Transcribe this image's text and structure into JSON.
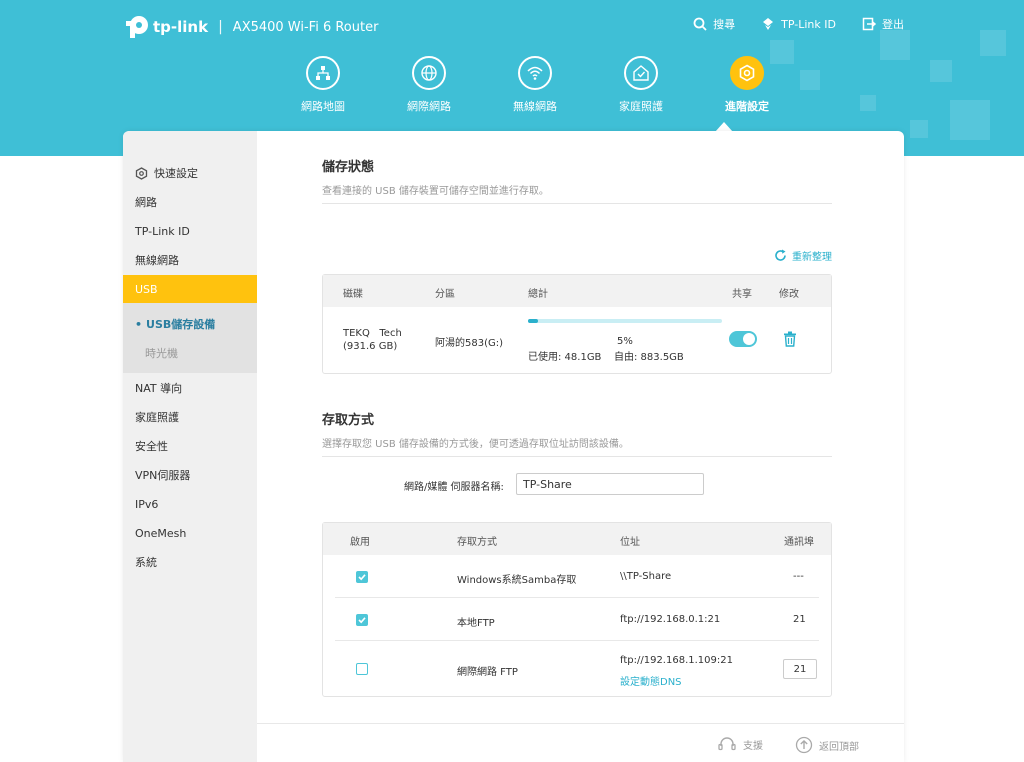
{
  "header": {
    "brand": "tp-link",
    "separator": "|",
    "model": "AX5400 Wi-Fi 6 Router",
    "top_links": [
      {
        "label": "搜尋",
        "icon": "search-icon"
      },
      {
        "label": "TP-Link ID",
        "icon": "tplink-id-icon"
      },
      {
        "label": "登出",
        "icon": "logout-icon"
      }
    ],
    "main_nav": [
      {
        "label": "網路地圖",
        "icon": "network-map-icon"
      },
      {
        "label": "網際網路",
        "icon": "internet-globe-icon"
      },
      {
        "label": "無線網路",
        "icon": "wifi-icon"
      },
      {
        "label": "家庭照護",
        "icon": "home-care-icon"
      },
      {
        "label": "進階設定",
        "icon": "advanced-gear-icon",
        "active": true
      }
    ]
  },
  "sidebar": {
    "items": [
      {
        "label": "快速設定",
        "icon": "quick-setup-icon"
      },
      {
        "label": "網路"
      },
      {
        "label": "TP-Link ID"
      },
      {
        "label": "無線網路"
      },
      {
        "label": "USB",
        "active": true
      },
      {
        "label": "NAT 導向"
      },
      {
        "label": "家庭照護"
      },
      {
        "label": "安全性"
      },
      {
        "label": "VPN伺服器"
      },
      {
        "label": "IPv6"
      },
      {
        "label": "OneMesh"
      },
      {
        "label": "系統"
      }
    ],
    "sub_items": [
      {
        "label": "USB儲存設備",
        "active": true,
        "bullet": "•"
      },
      {
        "label": "時光機"
      }
    ]
  },
  "storage": {
    "title": "儲存狀態",
    "desc": "查看連接的 USB 儲存裝置可儲存空間並進行存取。",
    "refresh_label": "重新整理",
    "columns": [
      "磁碟",
      "分區",
      "總計",
      "共享",
      "修改"
    ],
    "disk": {
      "name": "TEKQ   Tech (931.6 GB)",
      "partition": "阿湯的583(G:)",
      "percent_text": "5%",
      "used": "已使用: 48.1GB",
      "free": "自由: 883.5GB",
      "usage_fraction": 0.05,
      "shared": true
    }
  },
  "access": {
    "title": "存取方式",
    "desc": "選擇存取您 USB 儲存設備的方式後，便可透過存取位址訪問該設備。",
    "server_label": "網路/媒體 伺服器名稱:",
    "server_value": "TP-Share",
    "columns": [
      "啟用",
      "存取方式",
      "位址",
      "通訊埠"
    ],
    "rows": [
      {
        "enabled": true,
        "method": "Windows系統Samba存取",
        "address": "\\\\TP-Share",
        "port": "---"
      },
      {
        "enabled": true,
        "method": "本地FTP",
        "address": "ftp://192.168.0.1:21",
        "port": "21"
      },
      {
        "enabled": false,
        "method": "網際網路 FTP",
        "address": "ftp://192.168.1.109:21",
        "link": "設定動態DNS",
        "port": "21"
      }
    ]
  },
  "footer": {
    "support": "支援",
    "back_to_top": "返回頂部"
  },
  "colors": {
    "header_bg": "#3fbfd6",
    "accent_yellow": "#ffc20e",
    "accent_teal": "#2ab0cc"
  }
}
